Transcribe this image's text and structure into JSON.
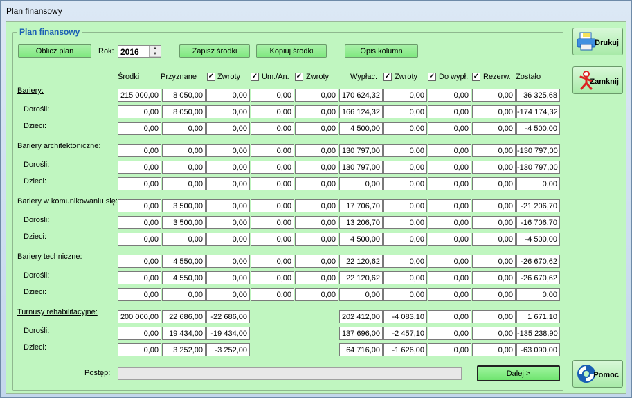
{
  "window": {
    "title": "Plan finansowy"
  },
  "group": {
    "legend": "Plan finansowy"
  },
  "toolbar": {
    "oblicz": "Oblicz plan",
    "rok_label": "Rok:",
    "rok_value": "2016",
    "zapisz": "Zapisz środki",
    "kopiuj": "Kopiuj środki",
    "opis": "Opis kolumn"
  },
  "headers": [
    "Środki",
    "Przyznane",
    "Zwroty",
    "Um./An.",
    "Zwroty",
    "Wypłac.",
    "Zwroty",
    "Do wypł.",
    "Rezerw.",
    "Zostało"
  ],
  "checkbox_mark": "✓",
  "rows": [
    {
      "label": "Bariery:",
      "values": [
        "215 000,00",
        "8 050,00",
        "0,00",
        "0,00",
        "0,00",
        "170 624,32",
        "0,00",
        "0,00",
        "0,00",
        "36 325,68"
      ]
    },
    {
      "label": "Dorośli:",
      "values": [
        "0,00",
        "8 050,00",
        "0,00",
        "0,00",
        "0,00",
        "166 124,32",
        "0,00",
        "0,00",
        "0,00",
        "-174 174,32"
      ]
    },
    {
      "label": "Dzieci:",
      "values": [
        "0,00",
        "0,00",
        "0,00",
        "0,00",
        "0,00",
        "4 500,00",
        "0,00",
        "0,00",
        "0,00",
        "-4 500,00"
      ]
    },
    {
      "label": "Bariery architektoniczne:",
      "values": [
        "0,00",
        "0,00",
        "0,00",
        "0,00",
        "0,00",
        "130 797,00",
        "0,00",
        "0,00",
        "0,00",
        "-130 797,00"
      ]
    },
    {
      "label": "Dorośli:",
      "values": [
        "0,00",
        "0,00",
        "0,00",
        "0,00",
        "0,00",
        "130 797,00",
        "0,00",
        "0,00",
        "0,00",
        "-130 797,00"
      ]
    },
    {
      "label": "Dzieci:",
      "values": [
        "0,00",
        "0,00",
        "0,00",
        "0,00",
        "0,00",
        "0,00",
        "0,00",
        "0,00",
        "0,00",
        "0,00"
      ]
    },
    {
      "label": "Bariery w komunikowaniu się:",
      "values": [
        "0,00",
        "3 500,00",
        "0,00",
        "0,00",
        "0,00",
        "17 706,70",
        "0,00",
        "0,00",
        "0,00",
        "-21 206,70"
      ]
    },
    {
      "label": "Dorośli:",
      "values": [
        "0,00",
        "3 500,00",
        "0,00",
        "0,00",
        "0,00",
        "13 206,70",
        "0,00",
        "0,00",
        "0,00",
        "-16 706,70"
      ]
    },
    {
      "label": "Dzieci:",
      "values": [
        "0,00",
        "0,00",
        "0,00",
        "0,00",
        "0,00",
        "4 500,00",
        "0,00",
        "0,00",
        "0,00",
        "-4 500,00"
      ]
    },
    {
      "label": "Bariery techniczne:",
      "values": [
        "0,00",
        "4 550,00",
        "0,00",
        "0,00",
        "0,00",
        "22 120,62",
        "0,00",
        "0,00",
        "0,00",
        "-26 670,62"
      ]
    },
    {
      "label": "Dorośli:",
      "values": [
        "0,00",
        "4 550,00",
        "0,00",
        "0,00",
        "0,00",
        "22 120,62",
        "0,00",
        "0,00",
        "0,00",
        "-26 670,62"
      ]
    },
    {
      "label": "Dzieci:",
      "values": [
        "0,00",
        "0,00",
        "0,00",
        "0,00",
        "0,00",
        "0,00",
        "0,00",
        "0,00",
        "0,00",
        "0,00"
      ]
    },
    {
      "label": "Turnusy rehabilitacyjne:",
      "values": [
        "200 000,00",
        "22 686,00",
        "-22 686,00",
        null,
        null,
        "202 412,00",
        "-4 083,10",
        "0,00",
        "0,00",
        "1 671,10"
      ]
    },
    {
      "label": "Dorośli:",
      "values": [
        "0,00",
        "19 434,00",
        "-19 434,00",
        null,
        null,
        "137 696,00",
        "-2 457,10",
        "0,00",
        "0,00",
        "-135 238,90"
      ]
    },
    {
      "label": "Dzieci:",
      "values": [
        "0,00",
        "3 252,00",
        "-3 252,00",
        null,
        null,
        "64 716,00",
        "-1 626,00",
        "0,00",
        "0,00",
        "-63 090,00"
      ]
    }
  ],
  "footer": {
    "postep_label": "Postęp:",
    "progress": 0,
    "dalej": "Dalej >"
  },
  "side": {
    "drukuj": "Drukuj",
    "zamknij": "Zamknij",
    "pomoc": "Pomoc"
  }
}
